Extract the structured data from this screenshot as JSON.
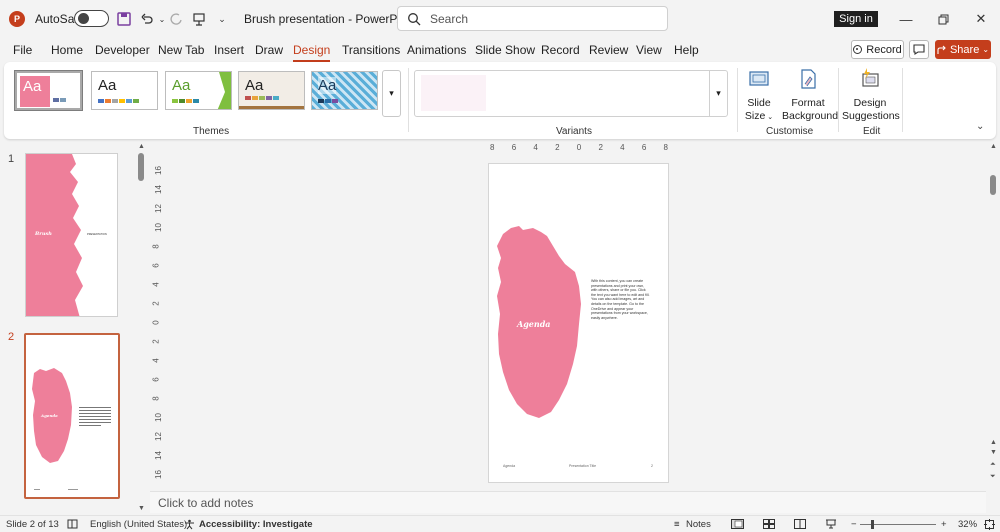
{
  "titlebar": {
    "autosave_label": "AutoSave",
    "doc_title": "Brush presentation  -  PowerP...",
    "search_placeholder": "Search",
    "signin_label": "Sign in"
  },
  "menu": {
    "tabs": [
      "File",
      "Home",
      "Developer",
      "New Tab",
      "Insert",
      "Draw",
      "Design",
      "Transitions",
      "Animations",
      "Slide Show",
      "Record",
      "Review",
      "View",
      "Help"
    ],
    "active": "Design",
    "record_label": "Record",
    "share_label": "Share"
  },
  "ribbon": {
    "themes_label": "Themes",
    "theme_text": "Aa",
    "variants_label": "Variants",
    "slide_size_label_1": "Slide",
    "slide_size_label_2": "Size",
    "format_bg_label_1": "Format",
    "format_bg_label_2": "Background",
    "customise_label": "Customise",
    "design_sugg_label_1": "Design",
    "design_sugg_label_2": "Suggestions",
    "edit_label": "Edit"
  },
  "thumbnails": {
    "slide1_num": "1",
    "slide2_num": "2",
    "slide1_title": "Brush",
    "slide1_sub": "PRESENTATION",
    "slide2_title": "Agenda"
  },
  "ruler": {
    "h_ticks": [
      "8",
      "6",
      "4",
      "2",
      "0",
      "2",
      "4",
      "6",
      "8"
    ],
    "v_ticks": [
      "16",
      "14",
      "12",
      "10",
      "8",
      "6",
      "4",
      "2",
      "0",
      "2",
      "4",
      "6",
      "8",
      "10",
      "12",
      "14",
      "16"
    ]
  },
  "slide": {
    "title": "Agenda",
    "body": "With this content, you can create presentations and print your own, with others, share or file you. Click the text you want here to edit and fill. You can also add images, art and details on the template. Go to the OneDrive and appear your presentations from your workspace, easily anywhere.",
    "footer_left": "Agenda",
    "footer_mid": "Presentation Title",
    "footer_right": "2"
  },
  "notes": {
    "placeholder": "Click to add notes"
  },
  "status": {
    "slide_info": "Slide 2 of 13",
    "language": "English (United States)",
    "accessibility": "Accessibility: Investigate",
    "notes_label": "Notes",
    "zoom": "32%"
  },
  "colors": {
    "accent": "#c43e1c",
    "brush_pink": "#ee7f9a"
  }
}
